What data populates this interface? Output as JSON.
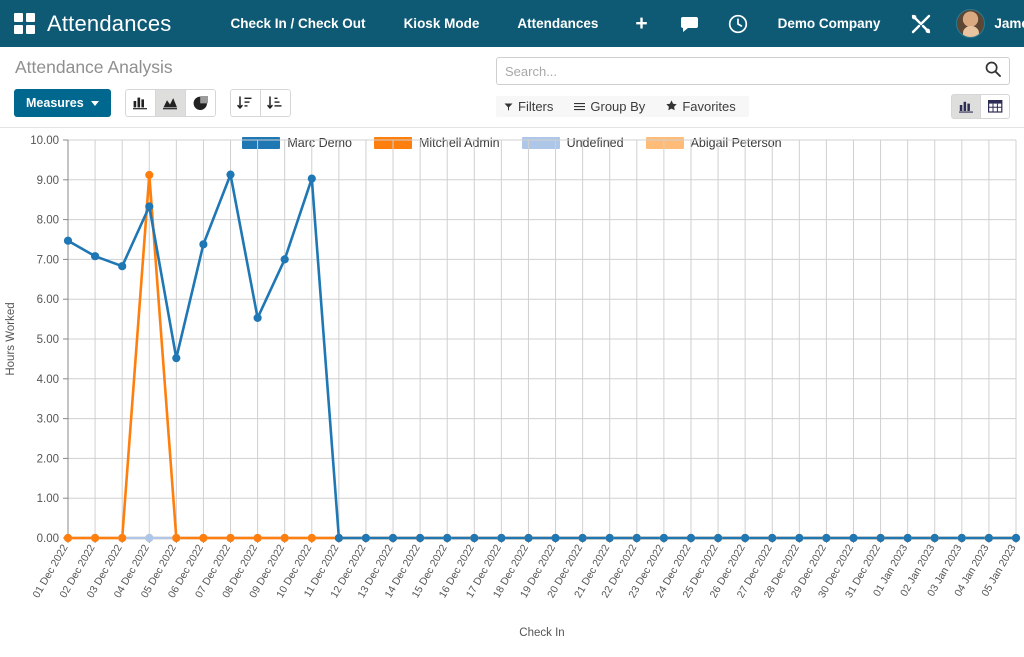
{
  "navbar": {
    "apps_icon": "apps-grid-icon",
    "brand": "Attendances",
    "menu_items": [
      {
        "label": "Check In / Check Out"
      },
      {
        "label": "Kiosk Mode"
      },
      {
        "label": "Attendances"
      }
    ],
    "plus_label": "+",
    "messages_icon": "chat-bubble-icon",
    "activity_icon": "clock-icon",
    "company": "Demo Company",
    "settings_icon": "tools-icon",
    "user_name": "James"
  },
  "control_panel": {
    "page_title": "Attendance Analysis",
    "measures_label": "Measures",
    "chart_type_buttons": [
      {
        "icon": "bar-chart-icon",
        "active": false
      },
      {
        "icon": "area-chart-icon",
        "active": true
      },
      {
        "icon": "pie-chart-icon",
        "active": false
      }
    ],
    "sort_buttons": [
      {
        "icon": "sort-descending-icon"
      },
      {
        "icon": "sort-ascending-icon"
      }
    ],
    "search": {
      "placeholder": "Search...",
      "value": "",
      "icon": "search-icon"
    },
    "filters": [
      {
        "label": "Filters",
        "icon": "filter-icon"
      },
      {
        "label": "Group By",
        "icon": "hamburger-icon"
      },
      {
        "label": "Favorites",
        "icon": "star-icon"
      }
    ],
    "view_buttons": [
      {
        "icon": "graph-view-icon",
        "active": true
      },
      {
        "icon": "pivot-view-icon",
        "active": false
      }
    ]
  },
  "chart_data": {
    "type": "line",
    "title": "",
    "xlabel": "Check In",
    "ylabel": "Hours Worked",
    "ylim": [
      0,
      10
    ],
    "ytick_labels": [
      "0.00",
      "1.00",
      "2.00",
      "3.00",
      "4.00",
      "5.00",
      "6.00",
      "7.00",
      "8.00",
      "9.00",
      "10.00"
    ],
    "grid": true,
    "legend_position": "top",
    "categories": [
      "01 Dec 2022",
      "02 Dec 2022",
      "03 Dec 2022",
      "04 Dec 2022",
      "05 Dec 2022",
      "06 Dec 2022",
      "07 Dec 2022",
      "08 Dec 2022",
      "09 Dec 2022",
      "10 Dec 2022",
      "11 Dec 2022",
      "12 Dec 2022",
      "13 Dec 2022",
      "14 Dec 2022",
      "15 Dec 2022",
      "16 Dec 2022",
      "17 Dec 2022",
      "18 Dec 2022",
      "19 Dec 2022",
      "20 Dec 2022",
      "21 Dec 2022",
      "22 Dec 2022",
      "23 Dec 2022",
      "24 Dec 2022",
      "25 Dec 2022",
      "26 Dec 2022",
      "27 Dec 2022",
      "28 Dec 2022",
      "29 Dec 2022",
      "30 Dec 2022",
      "31 Dec 2022",
      "01 Jan 2023",
      "02 Jan 2023",
      "03 Jan 2023",
      "04 Jan 2023",
      "05 Jan 2023"
    ],
    "series": [
      {
        "name": "Marc Demo",
        "color": "#1f77b4",
        "values": [
          7.47,
          7.08,
          6.83,
          8.33,
          4.52,
          7.38,
          9.13,
          5.53,
          7.0,
          9.03,
          0,
          0,
          0,
          0,
          0,
          0,
          0,
          0,
          0,
          0,
          0,
          0,
          0,
          0,
          0,
          0,
          0,
          0,
          0,
          0,
          0,
          0,
          0,
          0,
          0,
          0
        ]
      },
      {
        "name": "Mitchell Admin",
        "color": "#ff7f0e",
        "values": [
          0,
          0,
          0,
          9.12,
          0,
          0,
          0,
          0,
          0,
          0,
          0,
          0,
          0,
          0,
          0,
          0,
          0,
          0,
          0,
          0,
          0,
          0,
          0,
          0,
          0,
          0,
          0,
          0,
          0,
          0,
          0,
          0,
          0,
          0,
          0,
          0
        ]
      },
      {
        "name": "Undefined",
        "color": "#aec7e8",
        "values": [
          0,
          0,
          0,
          0,
          0,
          0,
          0,
          0,
          0,
          0,
          0,
          0,
          0,
          0,
          0,
          0,
          0,
          0,
          0,
          0,
          0,
          0,
          0,
          0,
          0,
          0,
          0,
          0,
          0,
          0,
          0,
          0,
          0,
          0,
          0,
          0
        ]
      },
      {
        "name": "Abigail Peterson",
        "color": "#ffbb78",
        "values": [
          0,
          0,
          0,
          0,
          0,
          0,
          0,
          0,
          0,
          0,
          0,
          0,
          0,
          0,
          0,
          0,
          0,
          0,
          0,
          0,
          0,
          0,
          0,
          0,
          0,
          0,
          0,
          0,
          0,
          0,
          0,
          0,
          0,
          0,
          0,
          0
        ]
      }
    ]
  }
}
